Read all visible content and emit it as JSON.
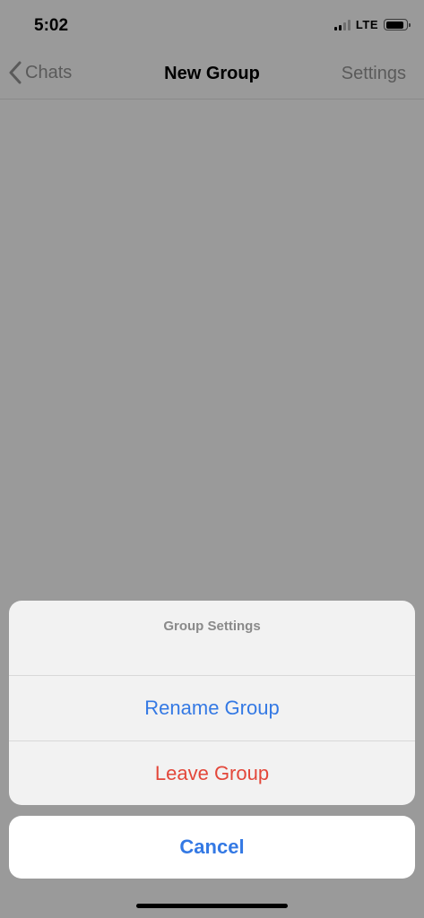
{
  "status_bar": {
    "time": "5:02",
    "network": "LTE",
    "signal_bars_active": 2,
    "signal_bars_total": 4,
    "battery_level": 0.9
  },
  "nav": {
    "back_label": "Chats",
    "title": "New Group",
    "right_label": "Settings",
    "back_icon": "chevron-left-icon"
  },
  "action_sheet": {
    "title": "Group Settings",
    "actions": [
      {
        "label": "Rename Group",
        "color": "#3479e4"
      },
      {
        "label": "Leave Group",
        "color": "#e3473a"
      }
    ],
    "cancel_label": "Cancel"
  },
  "colors": {
    "overlay_background": "#9a9a9a",
    "accent_blue": "#3479e4",
    "destructive_red": "#e3473a"
  }
}
